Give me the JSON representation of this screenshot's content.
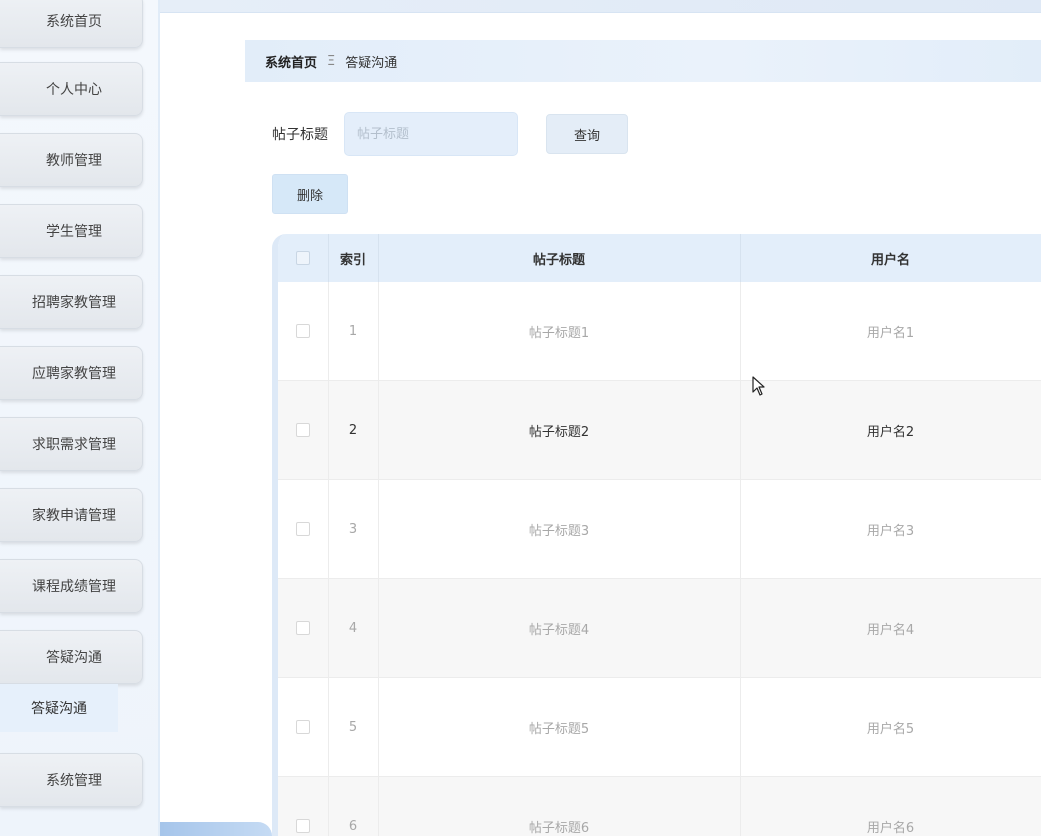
{
  "sidebar": {
    "items": [
      {
        "label": "系统首页"
      },
      {
        "label": "个人中心"
      },
      {
        "label": "教师管理"
      },
      {
        "label": "学生管理"
      },
      {
        "label": "招聘家教管理"
      },
      {
        "label": "应聘家教管理"
      },
      {
        "label": "求职需求管理"
      },
      {
        "label": "家教申请管理"
      },
      {
        "label": "课程成绩管理"
      },
      {
        "label": "答疑沟通"
      },
      {
        "label": "系统管理"
      }
    ],
    "submenu": {
      "label": "答疑沟通"
    }
  },
  "breadcrumb": {
    "home": "系统首页",
    "separator": "Ξ",
    "current": "答疑沟通"
  },
  "search": {
    "label": "帖子标题",
    "placeholder": "帖子标题",
    "value": "",
    "query_label": "查询"
  },
  "actions": {
    "delete_label": "删除"
  },
  "table": {
    "columns": [
      "索引",
      "帖子标题",
      "用户名"
    ],
    "rows": [
      {
        "index": "1",
        "title": "帖子标题1",
        "user": "用户名1"
      },
      {
        "index": "2",
        "title": "帖子标题2",
        "user": "用户名2"
      },
      {
        "index": "3",
        "title": "帖子标题3",
        "user": "用户名3"
      },
      {
        "index": "4",
        "title": "帖子标题4",
        "user": "用户名4"
      },
      {
        "index": "5",
        "title": "帖子标题5",
        "user": "用户名5"
      },
      {
        "index": "6",
        "title": "帖子标题6",
        "user": "用户名6"
      }
    ]
  },
  "colors": {
    "accent": "#e3eefa",
    "sidebar_button": "#e8ecf1",
    "delete_button": "#d6e8f8"
  }
}
